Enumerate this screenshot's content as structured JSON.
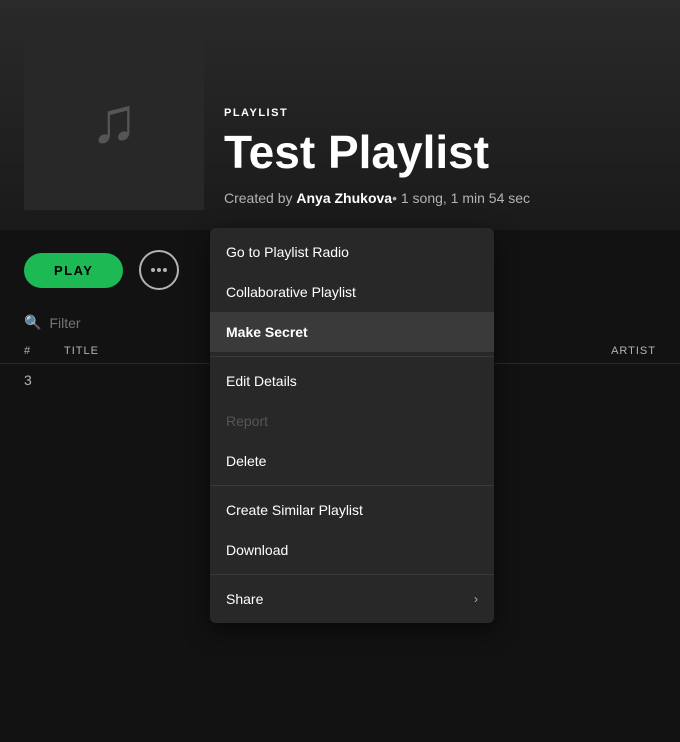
{
  "header": {
    "type_label": "PLAYLIST",
    "title": "Test Playlist",
    "created_by_prefix": "Created by ",
    "creator": "Anya Zhukova",
    "meta_suffix": "• 1 song, 1 min 54 sec"
  },
  "controls": {
    "play_label": "PLAY",
    "more_aria": "More options"
  },
  "filter": {
    "placeholder": "Filter"
  },
  "table": {
    "col_num": "#",
    "col_title": "TITLE",
    "col_artist": "ARTIST"
  },
  "track": {
    "number": "3"
  },
  "context_menu": {
    "items": [
      {
        "label": "Go to Playlist Radio",
        "section": 1,
        "disabled": false,
        "active": false,
        "has_arrow": false
      },
      {
        "label": "Collaborative Playlist",
        "section": 1,
        "disabled": false,
        "active": false,
        "has_arrow": false
      },
      {
        "label": "Make Secret",
        "section": 1,
        "disabled": false,
        "active": true,
        "has_arrow": false
      },
      {
        "label": "Edit Details",
        "section": 2,
        "disabled": false,
        "active": false,
        "has_arrow": false
      },
      {
        "label": "Report",
        "section": 2,
        "disabled": true,
        "active": false,
        "has_arrow": false
      },
      {
        "label": "Delete",
        "section": 2,
        "disabled": false,
        "active": false,
        "has_arrow": false
      },
      {
        "label": "Create Similar Playlist",
        "section": 3,
        "disabled": false,
        "active": false,
        "has_arrow": false
      },
      {
        "label": "Download",
        "section": 3,
        "disabled": false,
        "active": false,
        "has_arrow": false
      },
      {
        "label": "Share",
        "section": 4,
        "disabled": false,
        "active": false,
        "has_arrow": true
      }
    ]
  },
  "icons": {
    "music_note": "♪",
    "search": "🔍",
    "chevron_right": "›"
  }
}
